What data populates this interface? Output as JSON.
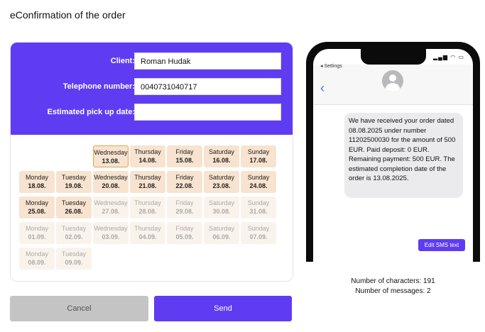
{
  "page": {
    "title": "eConfirmation of the order"
  },
  "form": {
    "client_label": "Client:",
    "client_value": "Roman Hudak",
    "phone_label": "Telephone number:",
    "phone_value": "0040731040717",
    "pickup_label": "Estimated pick up date:",
    "pickup_value": ""
  },
  "calendar": {
    "rows": [
      [
        null,
        null,
        {
          "day": "Wednesday",
          "date": "13.08.",
          "state": "today"
        },
        {
          "day": "Thursday",
          "date": "14.08.",
          "state": "active"
        },
        {
          "day": "Friday",
          "date": "15.08.",
          "state": "active"
        },
        {
          "day": "Saturday",
          "date": "16.08.",
          "state": "active"
        },
        {
          "day": "Sunday",
          "date": "17.08.",
          "state": "active"
        }
      ],
      [
        {
          "day": "Monday",
          "date": "18.08.",
          "state": "active"
        },
        {
          "day": "Tuesday",
          "date": "19.08.",
          "state": "active"
        },
        {
          "day": "Wednesday",
          "date": "20.08.",
          "state": "active"
        },
        {
          "day": "Thursday",
          "date": "21.08.",
          "state": "active"
        },
        {
          "day": "Friday",
          "date": "22.08.",
          "state": "active"
        },
        {
          "day": "Saturday",
          "date": "23.08.",
          "state": "active"
        },
        {
          "day": "Sunday",
          "date": "24.08.",
          "state": "active"
        }
      ],
      [
        {
          "day": "Monday",
          "date": "25.08.",
          "state": "active"
        },
        {
          "day": "Tuesday",
          "date": "26.08.",
          "state": "active"
        },
        {
          "day": "Wednesday",
          "date": "27.08.",
          "state": "inactive"
        },
        {
          "day": "Thursday",
          "date": "28.08.",
          "state": "inactive"
        },
        {
          "day": "Friday",
          "date": "29.08.",
          "state": "inactive"
        },
        {
          "day": "Saturday",
          "date": "30.08.",
          "state": "inactive"
        },
        {
          "day": "Sunday",
          "date": "31.08.",
          "state": "inactive"
        }
      ],
      [
        {
          "day": "Monday",
          "date": "01.09.",
          "state": "inactive"
        },
        {
          "day": "Tuesday",
          "date": "02.09.",
          "state": "inactive"
        },
        {
          "day": "Wednesday",
          "date": "03.09.",
          "state": "inactive"
        },
        {
          "day": "Thursday",
          "date": "04.09.",
          "state": "inactive"
        },
        {
          "day": "Friday",
          "date": "05.09.",
          "state": "inactive"
        },
        {
          "day": "Saturday",
          "date": "06.09.",
          "state": "inactive"
        },
        {
          "day": "Sunday",
          "date": "07.09.",
          "state": "inactive"
        }
      ],
      [
        {
          "day": "Monday",
          "date": "08.09.",
          "state": "inactive"
        },
        {
          "day": "Tuesday",
          "date": "09.09.",
          "state": "inactive"
        }
      ]
    ]
  },
  "buttons": {
    "cancel": "Cancel",
    "send": "Send"
  },
  "phone": {
    "status_back": "◂ Settings",
    "message": "We have received your order dated 08.08.2025 under number 11202500030 for the amount of 500 EUR. Paid deposit: 0 EUR. Remaining payment: 500 EUR. The estimated completion date of the order is 13.08.2025.",
    "edit_button": "Edit SMS text"
  },
  "counts": {
    "characters": "Number of characters: 191",
    "messages": "Number of messages: 2"
  },
  "colors": {
    "accent": "#5f3cf2",
    "cell_active": "#f7e3cf",
    "cell_today_border": "#e7a44a",
    "cell_inactive": "#faf3ec"
  }
}
